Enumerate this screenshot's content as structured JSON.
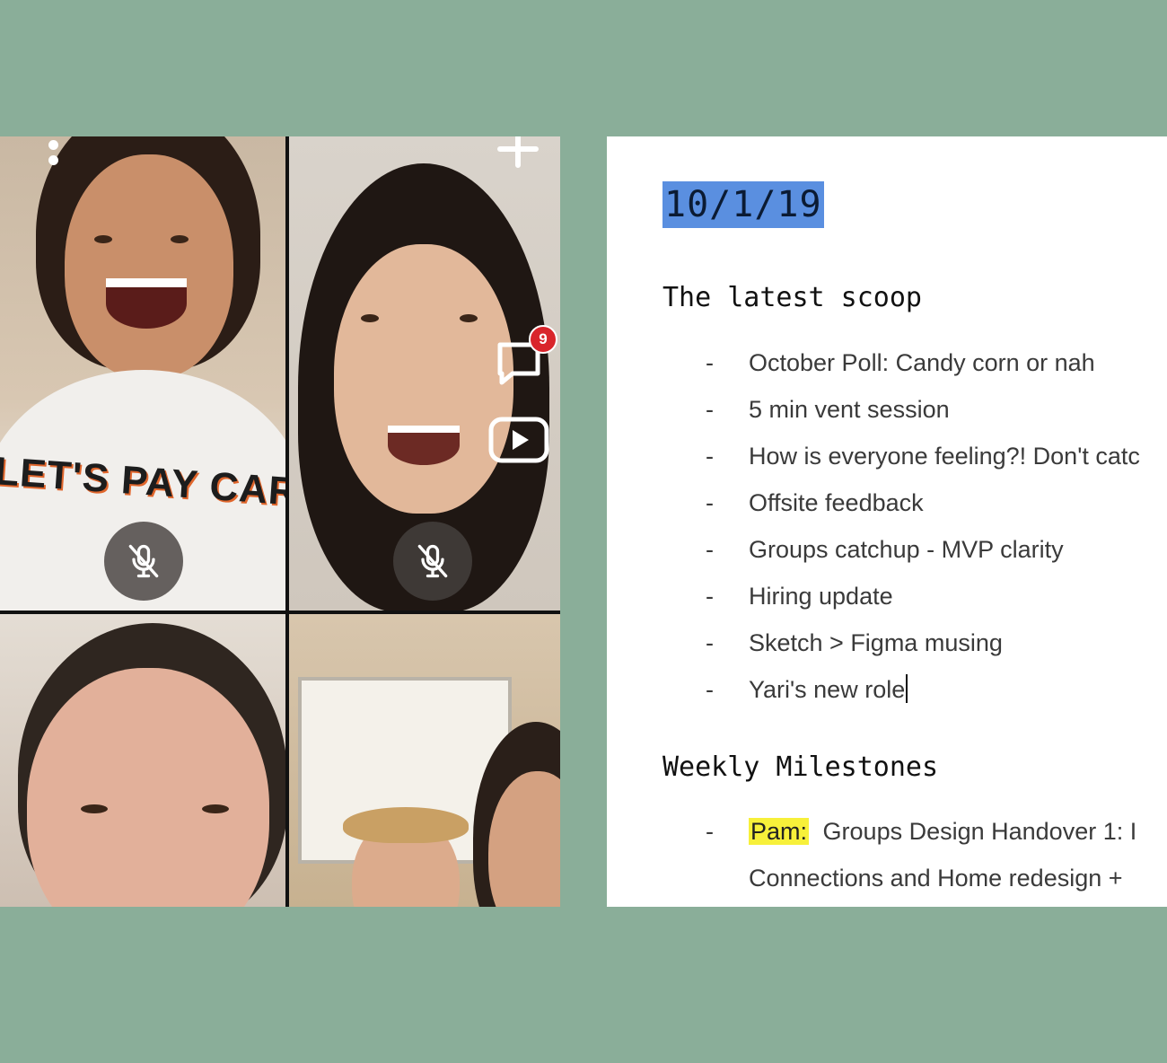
{
  "call": {
    "chat_badge_count": "9",
    "participants": [
      {
        "id": "p1",
        "muted": true
      },
      {
        "id": "p2",
        "muted": true
      },
      {
        "id": "p3",
        "muted": false
      },
      {
        "id": "p4",
        "muted": false
      }
    ],
    "shirt_text": "LET'S PAY CAR"
  },
  "doc": {
    "date": "10/1/19",
    "section1": {
      "heading": "The latest scoop",
      "items": [
        "October Poll: Candy corn or nah",
        "5 min vent session",
        "How is everyone feeling?! Don't catc",
        "Offsite feedback",
        "Groups catchup - MVP clarity",
        "Hiring update",
        "Sketch > Figma musing",
        "Yari's new role"
      ]
    },
    "section2": {
      "heading": "Weekly Milestones",
      "items": [
        {
          "name": "Pam:",
          "text": "Groups Design Handover 1: I"
        }
      ],
      "continuation": "Connections and Home redesign + "
    },
    "dash": "-"
  },
  "colors": {
    "background": "#8aae99",
    "date_highlight": "#5a8fe0",
    "name_highlight": "#f7f03a",
    "badge": "#d9252b"
  }
}
